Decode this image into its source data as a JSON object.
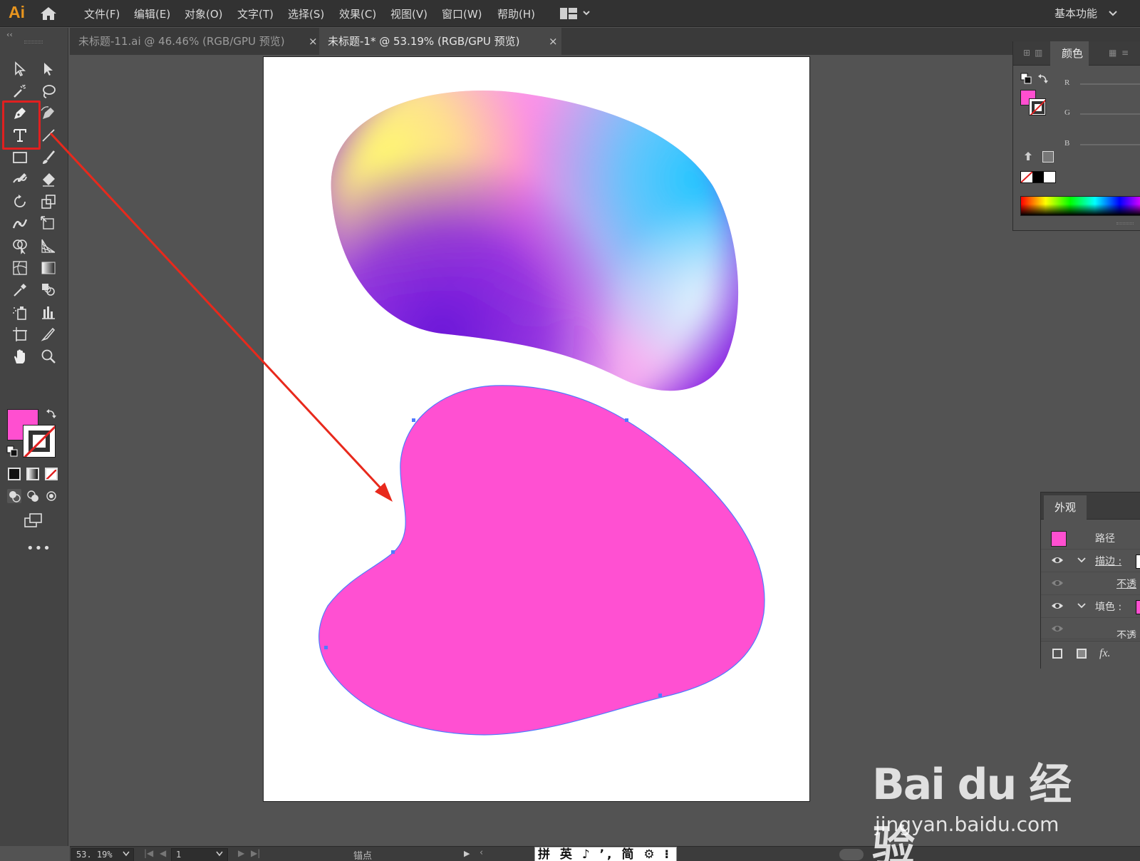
{
  "app": {
    "logo": "Ai",
    "menu": [
      "文件(F)",
      "编辑(E)",
      "对象(O)",
      "文字(T)",
      "选择(S)",
      "效果(C)",
      "视图(V)",
      "窗口(W)",
      "帮助(H)"
    ],
    "workspace": "基本功能"
  },
  "tabs": [
    {
      "label": "未标题-11.ai @ 46.46% (RGB/GPU 预览)",
      "close": "×",
      "active": false
    },
    {
      "label": "未标题-1* @ 53.19% (RGB/GPU 预览)",
      "close": "×",
      "active": true
    }
  ],
  "toolbar": {
    "collapse": "‹‹",
    "more": "•••",
    "highlighted_tools": [
      "pen-icon",
      "type-icon"
    ],
    "fill_color": "#ff4fd0",
    "stroke_color": "none",
    "tools": [
      "selection-icon",
      "direct-selection-icon",
      "magic-wand-icon",
      "lasso-icon",
      "pen-icon",
      "curvature-icon",
      "type-icon",
      "line-segment-icon",
      "rectangle-icon",
      "paintbrush-icon",
      "shaper-icon",
      "eraser-icon",
      "rotate-icon",
      "scale-icon",
      "width-icon",
      "free-transform-icon",
      "shape-builder-icon",
      "perspective-grid-icon",
      "mesh-icon",
      "gradient-icon",
      "eyedropper-icon",
      "blend-icon",
      "symbol-sprayer-icon",
      "column-graph-icon",
      "artboard-icon",
      "slice-icon",
      "hand-icon",
      "zoom-icon"
    ]
  },
  "color_panel": {
    "tab": "颜色",
    "channels": [
      "R",
      "G",
      "B"
    ]
  },
  "appearance_panel": {
    "tab": "外观",
    "object": "路径",
    "stroke_label": "描边 :",
    "stroke_opacity": "不透",
    "fill_label": "填色 :",
    "fill_opacity": "不透",
    "fx": "fx."
  },
  "artwork": {
    "blob_fill": "#ff50d2",
    "selection_color": "#4e7bff",
    "arrow_color": "#e8291c"
  },
  "statusbar": {
    "zoom": "53. 19%",
    "artboard": "1",
    "tool": "锚点",
    "ime": "拼 英 ♪ ’, 简 ⚙ ⁝"
  },
  "watermark": {
    "logo": "Bai du 经验",
    "url": "jingyan.baidu.com"
  }
}
